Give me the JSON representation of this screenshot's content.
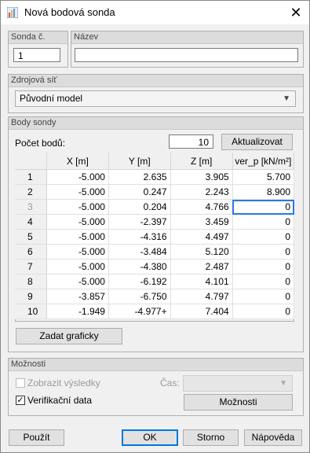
{
  "window": {
    "title": "Nová bodová sonda"
  },
  "sonda": {
    "label": "Sonda č.",
    "value": "1"
  },
  "nazev": {
    "label": "Název",
    "value": ""
  },
  "zdroj": {
    "label": "Zdrojová síť",
    "selected": "Původní model"
  },
  "body": {
    "label": "Body sondy",
    "count_label": "Počet bodů:",
    "count_value": "10",
    "update_button": "Aktualizovat",
    "columns": [
      "",
      "X [m]",
      "Y [m]",
      "Z [m]",
      "ver_p [kN/m²]"
    ],
    "rows": [
      [
        "1",
        "-5.000",
        "2.635",
        "3.905",
        "5.700"
      ],
      [
        "2",
        "-5.000",
        "0.247",
        "2.243",
        "8.900"
      ],
      [
        "3",
        "-5.000",
        "0.204",
        "4.766",
        "0"
      ],
      [
        "4",
        "-5.000",
        "-2.397",
        "3.459",
        "0"
      ],
      [
        "5",
        "-5.000",
        "-4.316",
        "4.497",
        "0"
      ],
      [
        "6",
        "-5.000",
        "-3.484",
        "5.120",
        "0"
      ],
      [
        "7",
        "-5.000",
        "-4.380",
        "2.487",
        "0"
      ],
      [
        "8",
        "-5.000",
        "-6.192",
        "4.101",
        "0"
      ],
      [
        "9",
        "-3.857",
        "-6.750",
        "4.797",
        "0"
      ],
      [
        "10",
        "-1.949",
        "-4.977+",
        "7.404",
        "0"
      ]
    ],
    "graphic_button": "Zadat graficky"
  },
  "moznosti": {
    "label": "Možnosti",
    "show_results": "Zobrazit výsledky",
    "verification": "Verifikační data",
    "time_label": "Čas:",
    "options_button": "Možnosti"
  },
  "footer": {
    "apply": "Použít",
    "ok": "OK",
    "cancel": "Storno",
    "help": "Nápověda"
  }
}
